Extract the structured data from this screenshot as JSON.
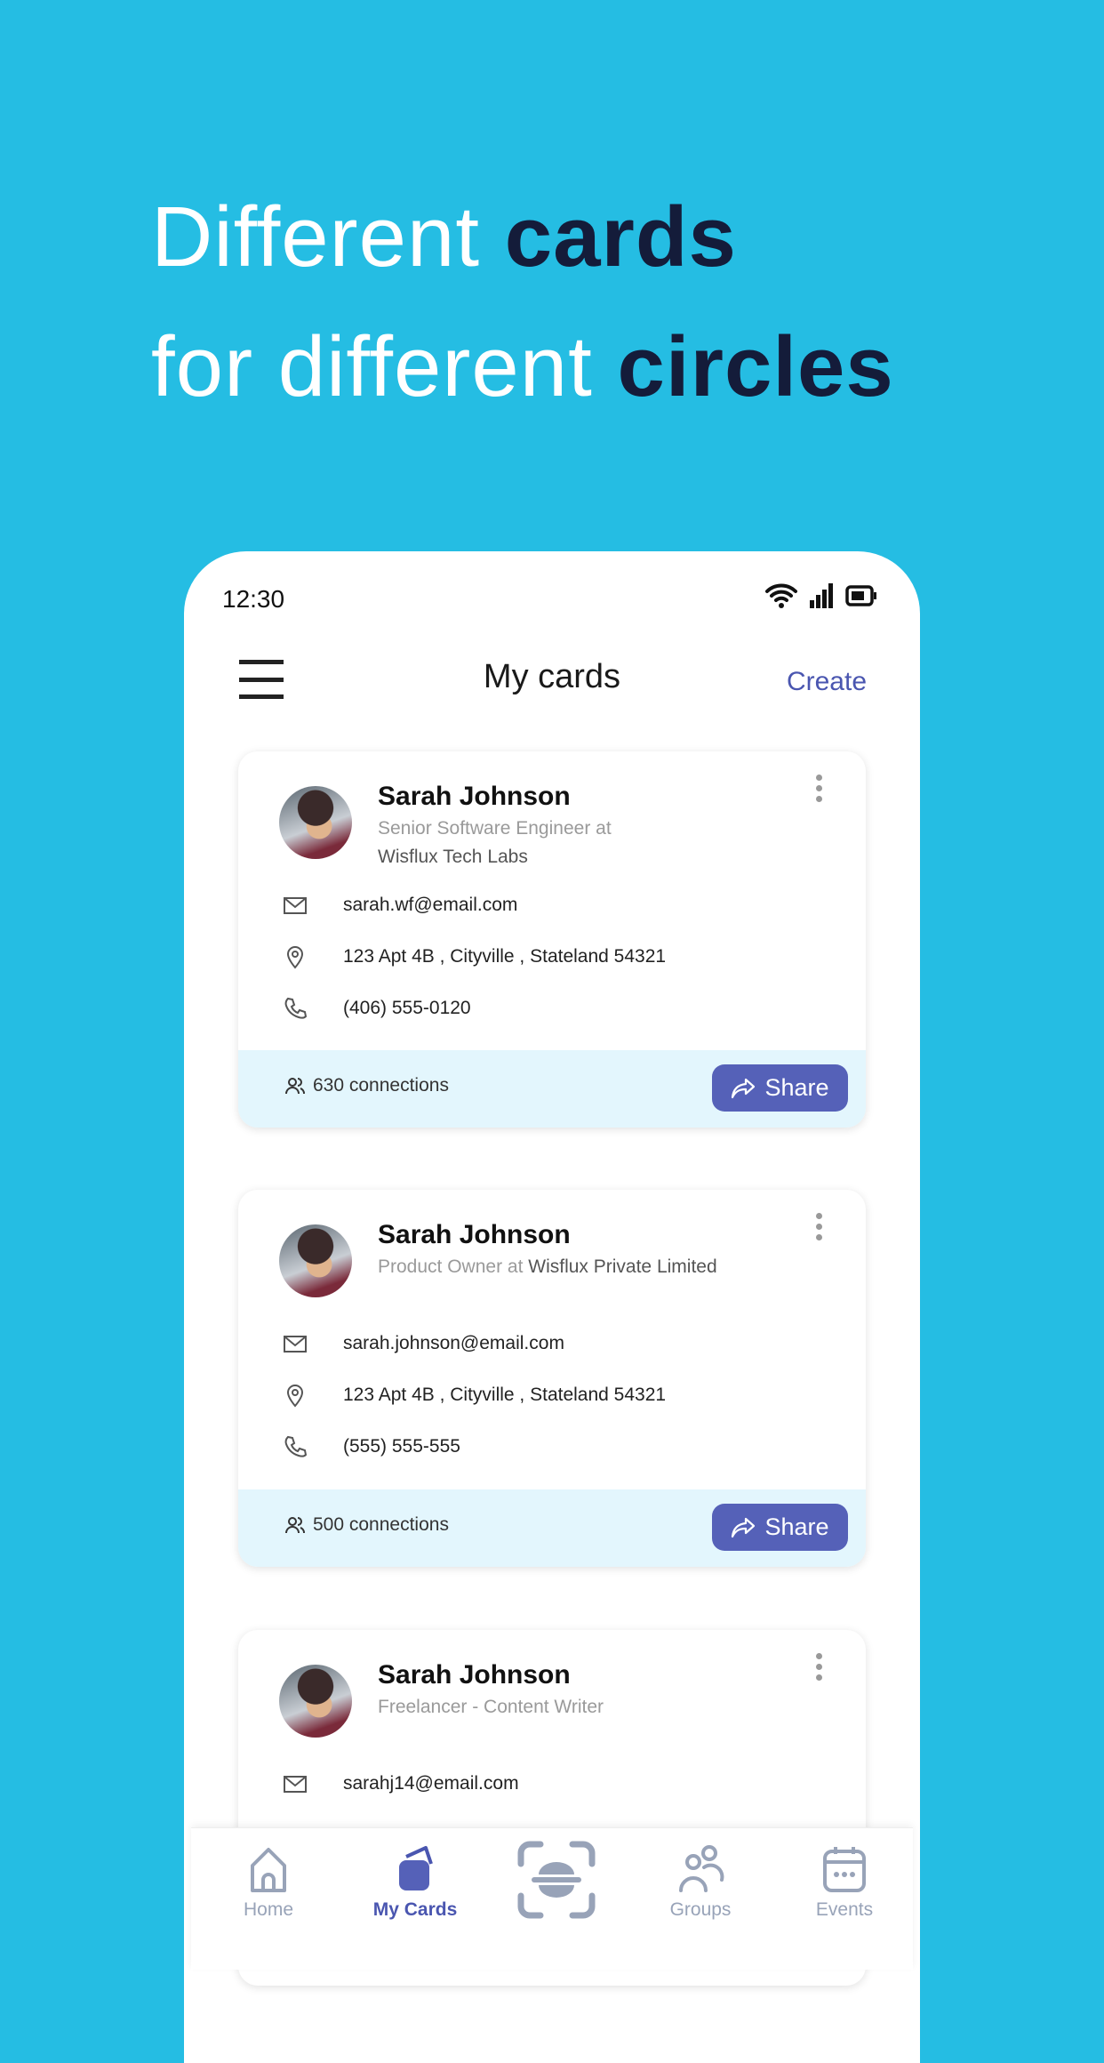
{
  "headline": {
    "line1_plain": "Different ",
    "line1_bold": "cards",
    "line2_plain": "for different ",
    "line2_bold": "circles"
  },
  "status_bar": {
    "time": "12:30",
    "icons": [
      "wifi-icon",
      "signal-icon",
      "battery-icon"
    ]
  },
  "header": {
    "title": "My cards",
    "create_label": "Create",
    "menu_icon": "hamburger-icon"
  },
  "colors": {
    "background": "#25bde3",
    "accent": "#5561b8",
    "headline_bold": "#141c3a",
    "card_footer": "#e3f6fd"
  },
  "cards": [
    {
      "name": "Sarah Johnson",
      "subtitle_gray": "Senior Software Engineer at",
      "subtitle_dark": "Wisflux Tech Labs",
      "email": "sarah.wf@email.com",
      "address": "123 Apt 4B , Cityville , Stateland  54321",
      "phone": "(406) 555-0120",
      "connections": "630 connections",
      "share_label": "Share"
    },
    {
      "name": "Sarah Johnson",
      "subtitle_gray": "Product Owner at ",
      "subtitle_dark": "Wisflux Private Limited",
      "email": "sarah.johnson@email.com",
      "address": "123 Apt 4B , Cityville , Stateland  54321",
      "phone": "(555) 555-555",
      "connections": "500 connections",
      "share_label": "Share"
    },
    {
      "name": "Sarah Johnson",
      "subtitle_gray": "Freelancer - Content Writer",
      "email": "sarahj14@email.com"
    }
  ],
  "nav": {
    "items": [
      {
        "label": "Home",
        "icon": "home-icon"
      },
      {
        "label": "My Cards",
        "icon": "cards-icon",
        "active": true
      },
      {
        "label": "",
        "icon": "scan-icon"
      },
      {
        "label": "Groups",
        "icon": "groups-icon"
      },
      {
        "label": "Events",
        "icon": "calendar-icon"
      }
    ]
  }
}
